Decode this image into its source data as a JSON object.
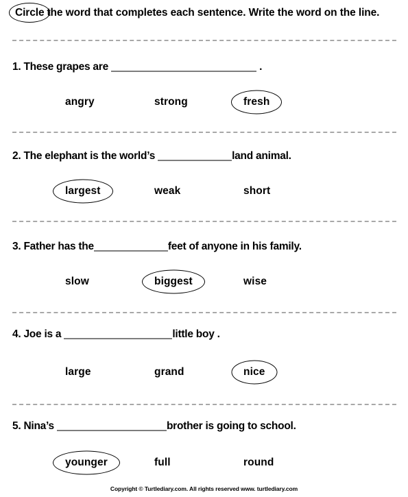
{
  "worksheet": {
    "instruction": {
      "circled_word": "Circle",
      "rest": "the word that completes each sentence. Write the word on the line."
    },
    "questions": [
      {
        "number": "1.",
        "before": "These grapes are",
        "blank_width": 212,
        "after": ".",
        "space_before_blank": true,
        "space_after_blank": true,
        "options": [
          {
            "label": "angry",
            "circled": false
          },
          {
            "label": "strong",
            "circled": false
          },
          {
            "label": "fresh",
            "circled": true
          }
        ]
      },
      {
        "number": "2.",
        "before": "The elephant is the world’s",
        "blank_width": 108,
        "after": "land animal.",
        "space_before_blank": true,
        "space_after_blank": false,
        "options": [
          {
            "label": "largest",
            "circled": true
          },
          {
            "label": "weak",
            "circled": false
          },
          {
            "label": "short",
            "circled": false
          }
        ]
      },
      {
        "number": "3.",
        "before": "Father has the",
        "blank_width": 108,
        "after": "feet of anyone in his family.",
        "space_before_blank": false,
        "space_after_blank": false,
        "options": [
          {
            "label": "slow",
            "circled": false
          },
          {
            "label": "biggest",
            "circled": true
          },
          {
            "label": "wise",
            "circled": false
          }
        ]
      },
      {
        "number": "4.",
        "before": "Joe is a",
        "blank_width": 158,
        "after": "little boy .",
        "space_before_blank": true,
        "space_after_blank": false,
        "options": [
          {
            "label": "large",
            "circled": false
          },
          {
            "label": "grand",
            "circled": false
          },
          {
            "label": "nice",
            "circled": true
          }
        ]
      },
      {
        "number": "5.",
        "before": "Nina’s",
        "blank_width": 160,
        "after": "brother is going to school.",
        "space_before_blank": true,
        "space_after_blank": false,
        "options": [
          {
            "label": "younger",
            "circled": true
          },
          {
            "label": "full",
            "circled": false
          },
          {
            "label": "round",
            "circled": false
          }
        ]
      }
    ],
    "footer": "Copyright © Turtlediary.com. All rights reserved   www. turtlediary.com",
    "colors": {
      "text": "#000000",
      "separator": "#a8a8a8",
      "blank_rule": "#7d7d7d",
      "background": "#ffffff"
    }
  }
}
